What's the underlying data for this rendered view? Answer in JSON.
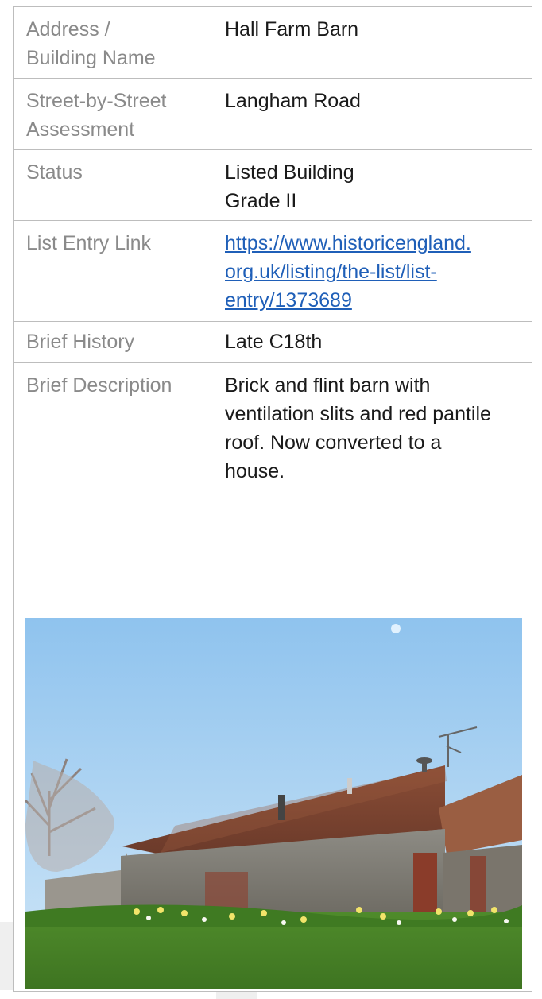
{
  "rows": [
    {
      "label": "Address /\nBuilding Name",
      "value": "Hall Farm Barn"
    },
    {
      "label": "Street-by-Street\nAssessment",
      "value": "Langham Road"
    },
    {
      "label": "Status",
      "value": "Listed Building\nGrade II"
    },
    {
      "label": "List Entry Link",
      "value": "https://www.historicengland.\norg.uk/listing/the-list/list-\nentry/1373689"
    },
    {
      "label": "Brief History",
      "value": "Late C18th"
    },
    {
      "label": "Brief Description",
      "value": "Brick and flint barn with\nventilation slits and red pantile\nroof. Now converted to a\nhouse."
    }
  ],
  "colors": {
    "label": "#8a8a8a",
    "value": "#1a1a1a",
    "link": "#1f5fb8",
    "border": "#bdbdbd"
  }
}
